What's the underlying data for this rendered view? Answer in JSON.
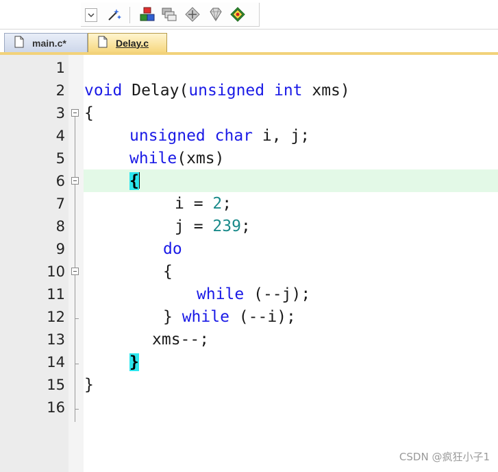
{
  "tabs": [
    {
      "label": "main.c*",
      "active": false
    },
    {
      "label": "Delay.c",
      "active": true
    }
  ],
  "toolbar": {
    "icons": [
      "dropdown-arrow-icon",
      "wand-icon",
      "build-blocks-icon",
      "windows-stack-icon",
      "diamond-arrows-icon",
      "gem-icon",
      "chip-grid-icon"
    ]
  },
  "editor": {
    "current_line": 6,
    "lines": [
      {
        "n": "1",
        "text": ""
      },
      {
        "n": "2",
        "text": "void Delay(unsigned int xms)"
      },
      {
        "n": "3",
        "text": "{"
      },
      {
        "n": "4",
        "text": "    unsigned char i, j;"
      },
      {
        "n": "5",
        "text": "    while(xms)"
      },
      {
        "n": "6",
        "text": "    {"
      },
      {
        "n": "7",
        "text": "        i = 2;"
      },
      {
        "n": "8",
        "text": "        j = 239;"
      },
      {
        "n": "9",
        "text": "       do"
      },
      {
        "n": "10",
        "text": "       {"
      },
      {
        "n": "11",
        "text": "          while (--j);"
      },
      {
        "n": "12",
        "text": "       } while (--i);"
      },
      {
        "n": "13",
        "text": "      xms--;"
      },
      {
        "n": "14",
        "text": "    }"
      },
      {
        "n": "15",
        "text": "}"
      },
      {
        "n": "16",
        "text": ""
      }
    ]
  },
  "watermark": "CSDN @疯狂小子1",
  "colors": {
    "keyword": "#1a1ae6",
    "number": "#1a8a8a",
    "current_line": "#e3f9e7",
    "brace_highlight": "#2ee6ee",
    "active_tab": "#f6d77f"
  }
}
